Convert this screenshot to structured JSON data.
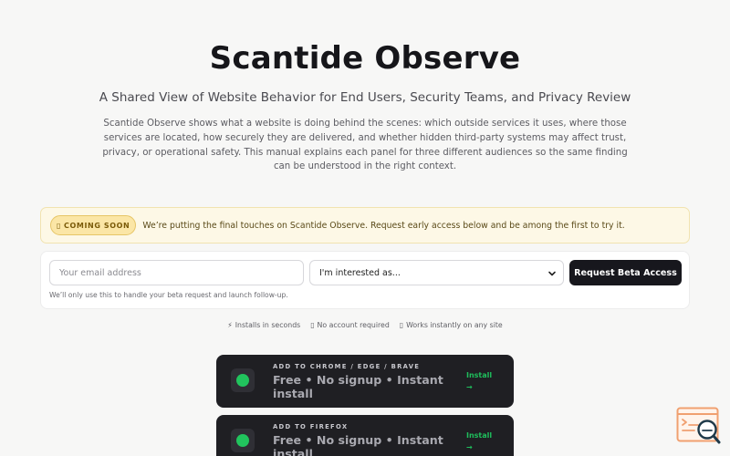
{
  "header": {
    "title": "Scantide Observe",
    "subtitle": "A Shared View of Website Behavior for End Users, Security Teams, and Privacy Review",
    "intro": "Scantide Observe shows what a website is doing behind the scenes: which outside services it uses, where those services are located, how securely they are delivered, and whether hidden third-party systems may affect trust, privacy, or operational safety. This manual explains each panel for three different audiences so the same finding can be understood in the right context."
  },
  "notice": {
    "badge_glyph": "▯",
    "badge_label": "COMING SOON",
    "text": "We’re putting the final touches on Scantide Observe. Request early access below and be among the first to try it."
  },
  "signup": {
    "email_placeholder": "Your email address",
    "email_value": "",
    "role_selected": "I'm interested as...",
    "cta_label": "Request Beta Access",
    "helper": "We’ll only use this to handle your beta request and launch follow-up."
  },
  "features": [
    {
      "glyph": "⚡",
      "label": "Installs in seconds"
    },
    {
      "glyph": "▯",
      "label": "No account required"
    },
    {
      "glyph": "▯",
      "label": "Works instantly on any site"
    }
  ],
  "install_cards": [
    {
      "eyebrow": "ADD TO CHROME / EDGE / BRAVE",
      "headline": "Free • No signup • Instant install",
      "action": "Install",
      "arrow": "→"
    },
    {
      "eyebrow": "ADD TO FIREFOX",
      "headline": "Free • No signup • Instant install",
      "action": "Install",
      "arrow": "→"
    }
  ],
  "colors": {
    "background": "#f7f7f6",
    "cta": "#17171d",
    "accent_green": "#21c45d",
    "notice_bg": "#fdf8e6",
    "widget_orange": "#f0a070"
  }
}
